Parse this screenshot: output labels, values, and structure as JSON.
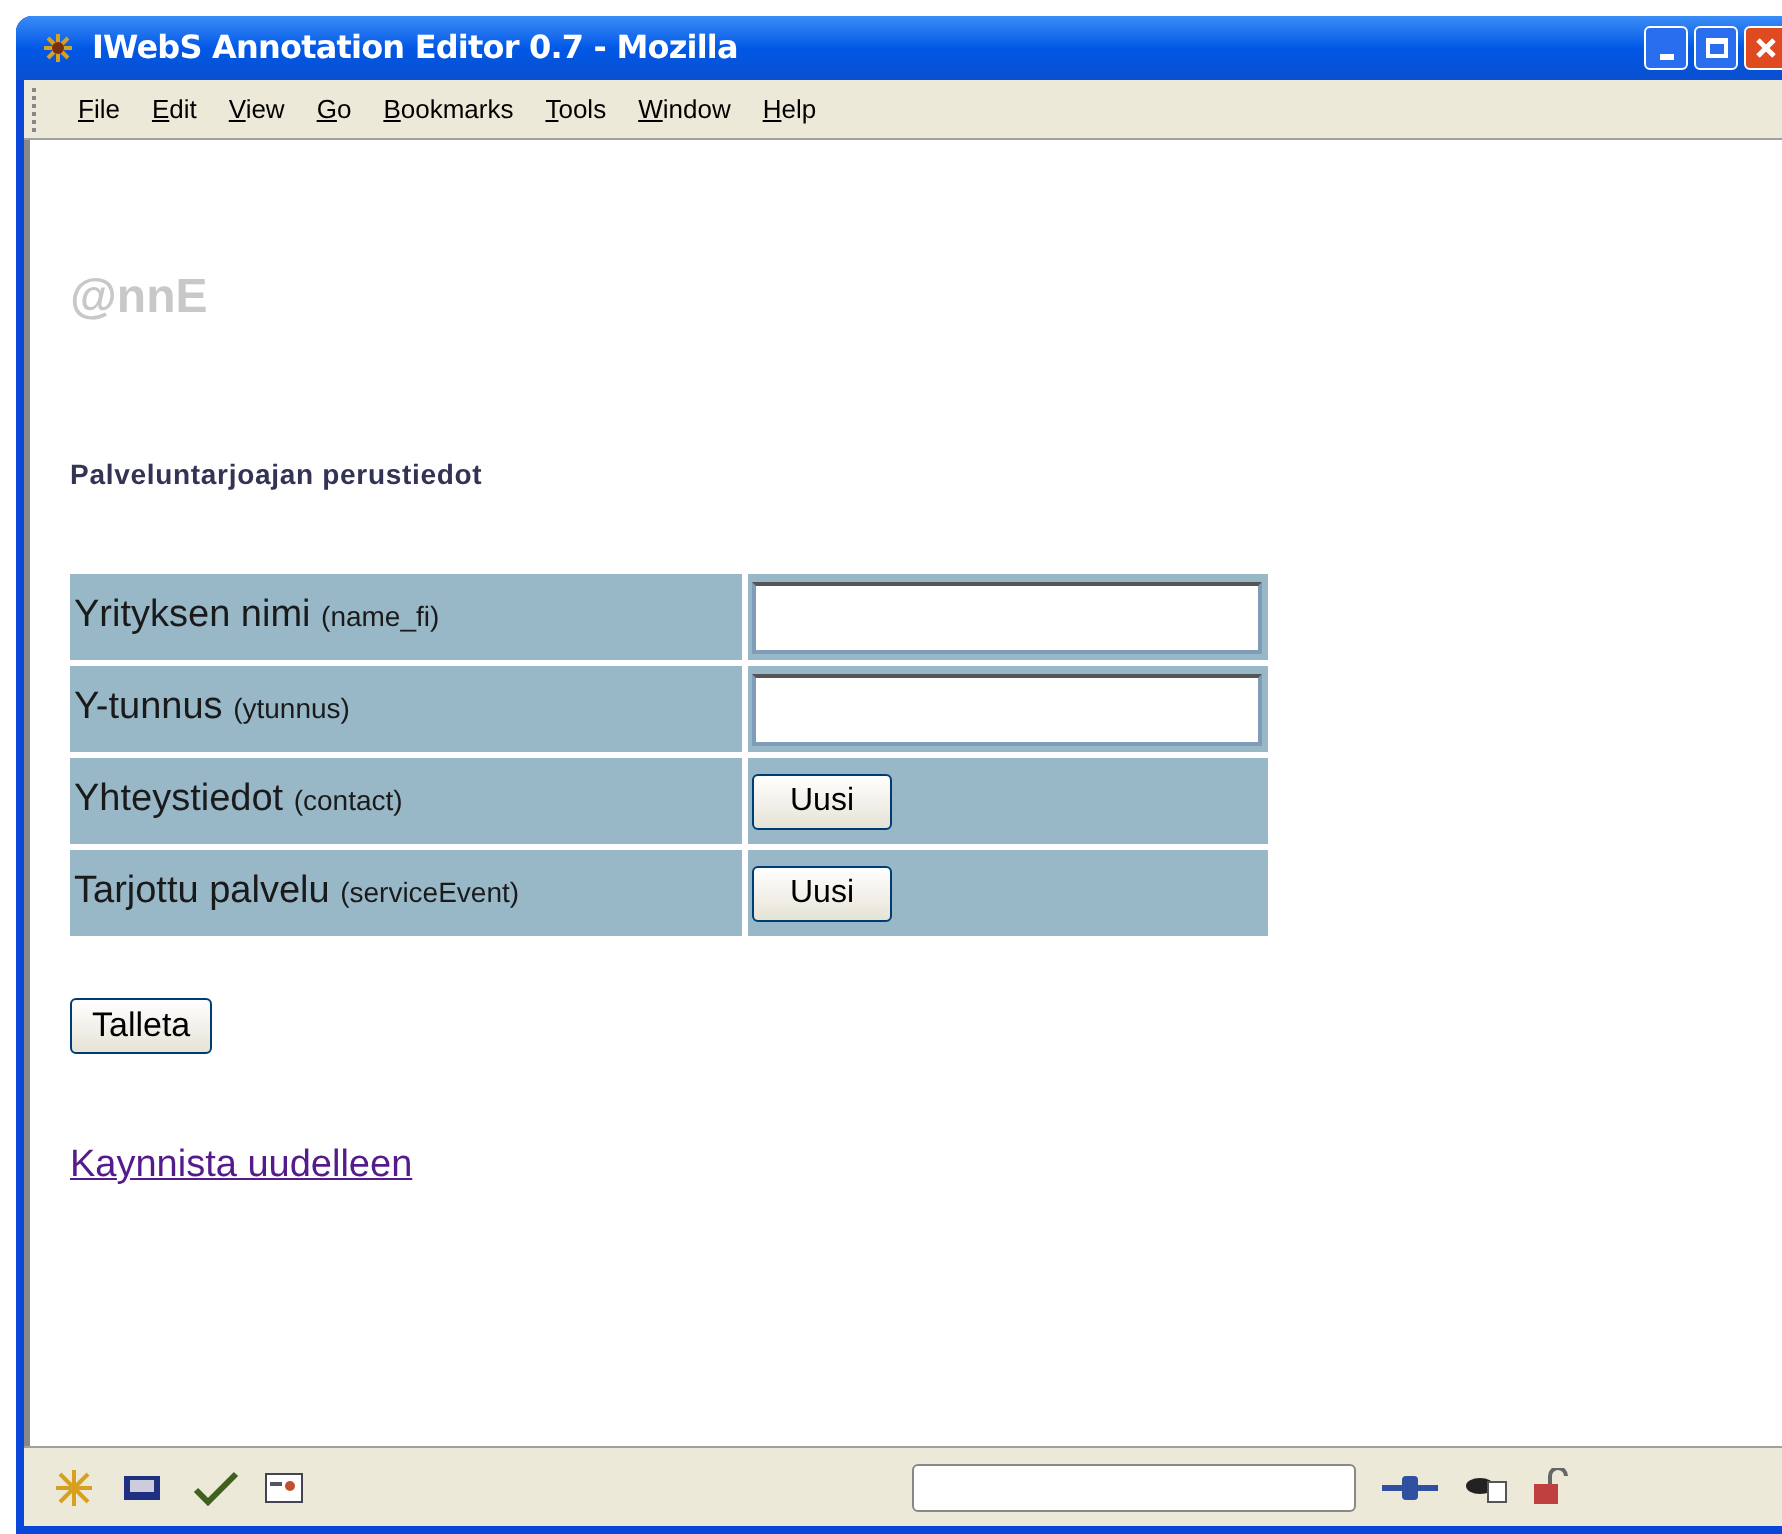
{
  "window": {
    "title": "IWebS Annotation Editor 0.7 - Mozilla"
  },
  "menu": [
    {
      "accel": "F",
      "rest": "ile"
    },
    {
      "accel": "E",
      "rest": "dit"
    },
    {
      "accel": "V",
      "rest": "iew"
    },
    {
      "accel": "G",
      "rest": "o"
    },
    {
      "accel": "B",
      "rest": "ookmarks"
    },
    {
      "accel": "T",
      "rest": "ools"
    },
    {
      "accel": "W",
      "rest": "indow"
    },
    {
      "accel": "H",
      "rest": "elp"
    }
  ],
  "logo": "@nnE",
  "heading": "Palveluntarjoajan perustiedot",
  "form": [
    {
      "kind": "text",
      "label": "Yrityksen nimi",
      "field": "(name_fi)"
    },
    {
      "kind": "text",
      "label": "Y-tunnus",
      "field": "(ytunnus)"
    },
    {
      "kind": "button",
      "label": "Yhteystiedot",
      "field": "(contact)",
      "button": "Uusi"
    },
    {
      "kind": "button",
      "label": "Tarjottu palvelu",
      "field": "(serviceEvent)",
      "button": "Uusi"
    }
  ],
  "save_button": "Talleta",
  "link": "Kaynnista uudelleen"
}
